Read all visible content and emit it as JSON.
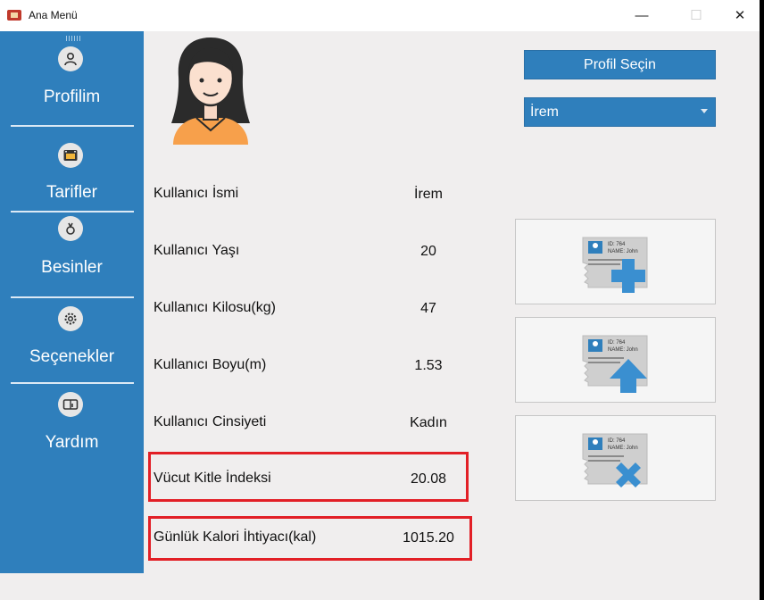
{
  "window": {
    "title": "Ana Menü",
    "minimize": "—",
    "maximize": "☐",
    "close": "✕"
  },
  "sidebar": {
    "items": [
      {
        "label": "Profilim",
        "icon": "person-icon"
      },
      {
        "label": "Tarifler",
        "icon": "oven-icon"
      },
      {
        "label": "Besinler",
        "icon": "food-icon"
      },
      {
        "label": "Seçenekler",
        "icon": "gear-icon"
      },
      {
        "label": "Yardım",
        "icon": "book-icon"
      }
    ]
  },
  "profile": {
    "select_button": "Profil Seçin",
    "selected_profile": "İrem",
    "fields": [
      {
        "label": "Kullanıcı İsmi",
        "value": "İrem"
      },
      {
        "label": "Kullanıcı Yaşı",
        "value": "20"
      },
      {
        "label": "Kullanıcı Kilosu(kg)",
        "value": "47"
      },
      {
        "label": "Kullanıcı Boyu(m)",
        "value": "1.53"
      },
      {
        "label": "Kullanıcı Cinsiyeti",
        "value": "Kadın"
      },
      {
        "label": "Vücut Kitle İndeksi",
        "value": "20.08"
      },
      {
        "label": "Günlük Kalori İhtiyacı(kal)",
        "value": "1015.20"
      }
    ]
  },
  "cards": [
    {
      "icon": "id-card-add-icon",
      "id_text": "ID: 764",
      "name_text": "NAME: John"
    },
    {
      "icon": "id-card-update-icon",
      "id_text": "ID: 764",
      "name_text": "NAME: John"
    },
    {
      "icon": "id-card-delete-icon",
      "id_text": "ID: 764",
      "name_text": "NAME: John"
    }
  ],
  "colors": {
    "sidebar": "#2f7fbc",
    "highlight": "#e21f26",
    "accent": "#3a8fd0"
  }
}
